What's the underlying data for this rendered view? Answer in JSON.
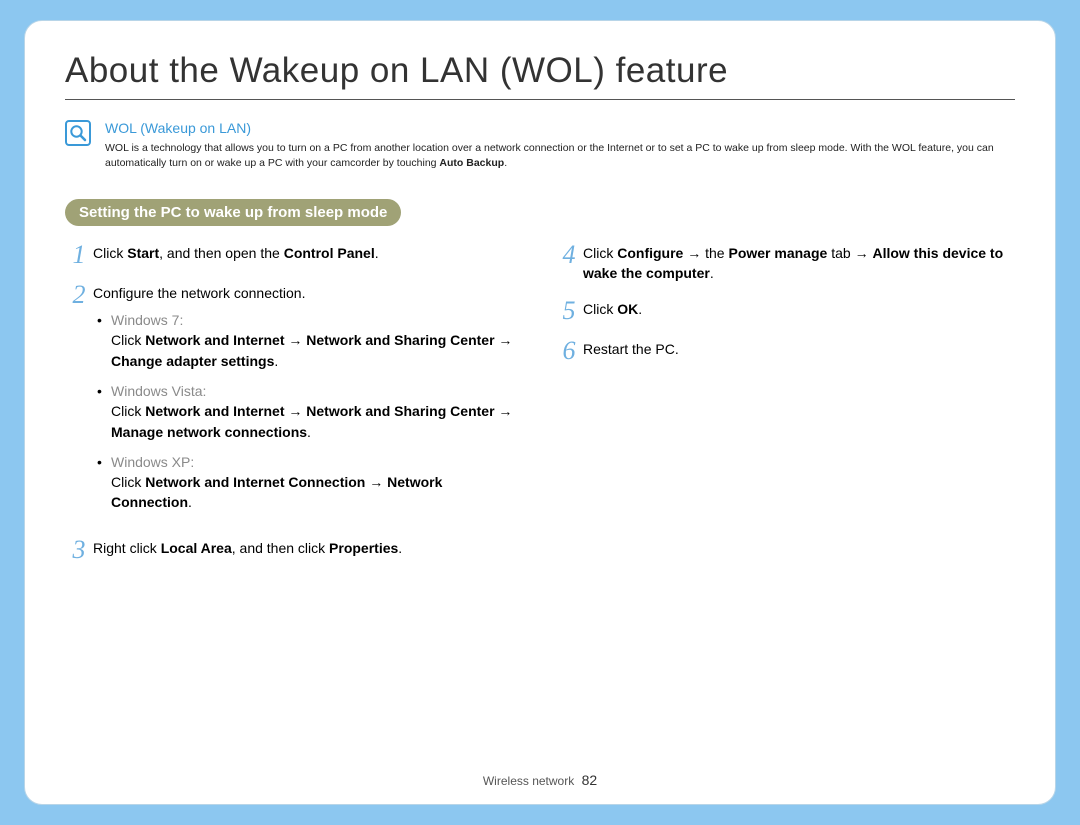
{
  "title": "About the Wakeup on LAN (WOL) feature",
  "info": {
    "heading": "WOL (Wakeup on LAN)",
    "desc_before": "WOL is a technology  that allows you to turn on a PC from another location over a network connection or the Internet or to set a PC to wake up from sleep mode. With the WOL feature, you can automatically turn on or wake up a PC with your camcorder by touching ",
    "desc_bold": "Auto Backup",
    "desc_after": "."
  },
  "section_label": "Setting the PC to wake up from sleep mode",
  "steps": {
    "s1": {
      "num": "1",
      "a": "Click ",
      "b1": "Start",
      "c": ", and then open the ",
      "b2": "Control Panel",
      "d": "."
    },
    "s2": {
      "num": "2",
      "text": "Configure the network connection.",
      "subs": {
        "win7": {
          "label": "Windows 7:",
          "a": "Click ",
          "b1": "Network and Internet",
          "arr1": " → ",
          "b2": "Network and Sharing Center",
          "arr2": " → ",
          "b3": "Change adapter settings",
          "end": "."
        },
        "vista": {
          "label": "Windows Vista:",
          "a": "Click ",
          "b1": "Network and Internet",
          "arr1": " → ",
          "b2": "Network and Sharing Center",
          "arr2": " → ",
          "b3": "Manage network connections",
          "end": "."
        },
        "xp": {
          "label": "Windows XP:",
          "a": "Click ",
          "b1": "Network and Internet Connection",
          "arr1": " → ",
          "b2": "Network Connection",
          "end": "."
        }
      }
    },
    "s3": {
      "num": "3",
      "a": "Right click ",
      "b1": "Local Area",
      "c": ", and then click ",
      "b2": "Properties",
      "d": "."
    },
    "s4": {
      "num": "4",
      "a": "Click ",
      "b1": "Configure",
      "arr1": " → ",
      "c": "the ",
      "b2": "Power manage",
      "d": " tab ",
      "arr2": "→ ",
      "b3": "Allow this device to wake the computer",
      "e": "."
    },
    "s5": {
      "num": "5",
      "a": "Click ",
      "b1": "OK",
      "c": "."
    },
    "s6": {
      "num": "6",
      "text": "Restart the PC."
    }
  },
  "footer": {
    "section": "Wireless network",
    "page": "82"
  }
}
